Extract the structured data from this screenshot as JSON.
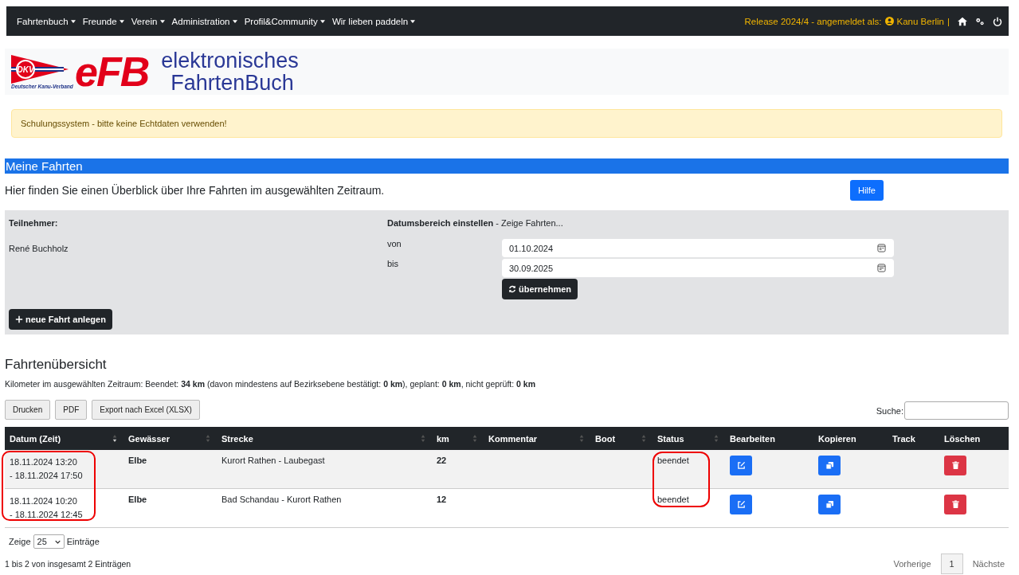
{
  "navbar": {
    "menus": [
      {
        "label": "Fahrtenbuch"
      },
      {
        "label": "Freunde"
      },
      {
        "label": "Verein"
      },
      {
        "label": "Administration"
      },
      {
        "label": "Profil&Community"
      },
      {
        "label": "Wir lieben paddeln"
      }
    ],
    "status_text": "Release 2024/4 - angemeldet als:",
    "user": "Kanu Berlin",
    "separator": "|"
  },
  "logo": {
    "badge": "DKV",
    "association": "Deutscher Kanu-Verband",
    "short": "eFB",
    "line_1": "elektronisches",
    "line_2": "FahrtenBuch"
  },
  "alert": "Schulungssystem - bitte keine Echtdaten verwenden!",
  "section": {
    "title": "Meine Fahrten",
    "description": "Hier finden Sie einen Überblick über Ihre Fahrten im ausgewählten Zeitraum.",
    "help_button": "Hilfe"
  },
  "filter": {
    "participant_label": "Teilnehmer:",
    "participant": "René Buchholz",
    "range_title": "**Datumsbereich einstellen** - Zeige Fahrten...",
    "from_label": "von",
    "from_value": "01.10.2024",
    "to_label": "bis",
    "to_value": "30.09.2025",
    "apply_button": "übernehmen",
    "new_button": "neue Fahrt anlegen"
  },
  "overview": {
    "title": "Fahrtenübersicht",
    "summary": "Kilometer im ausgewählten Zeitraum: Beendet: **34 km** (davon mindestens auf Bezirksebene bestätigt: **0 km**), geplant: **0 km**, nicht geprüft: **0 km**",
    "export_buttons": [
      "Drucken",
      "PDF",
      "Export nach Excel (XLSX)"
    ],
    "search_label": "Suche:"
  },
  "table": {
    "columns": [
      {
        "label": "Datum (Zeit)",
        "sortable": true,
        "sorted": true,
        "circled": true
      },
      {
        "label": "Gewässer",
        "sortable": true,
        "sorted": false,
        "circled": false
      },
      {
        "label": "Strecke",
        "sortable": true,
        "sorted": false,
        "circled": false
      },
      {
        "label": "km",
        "sortable": true,
        "sorted": false,
        "circled": false
      },
      {
        "label": "Kommentar",
        "sortable": true,
        "sorted": false,
        "circled": false
      },
      {
        "label": "Boot",
        "sortable": true,
        "sorted": false,
        "circled": false
      },
      {
        "label": "Status",
        "sortable": true,
        "sorted": false,
        "circled": true
      },
      {
        "label": "Bearbeiten",
        "sortable": false,
        "circled": false
      },
      {
        "label": "Kopieren",
        "sortable": false,
        "circled": false
      },
      {
        "label": "Track",
        "sortable": false,
        "circled": false
      },
      {
        "label": "Löschen",
        "sortable": false,
        "circled": false
      }
    ],
    "rows": [
      {
        "start": "18.11.2024 13:20",
        "end": "- 18.11.2024 17:50",
        "water": "Elbe",
        "route": "Kurort Rathen - Laubegast",
        "km": "22",
        "status": "beendet"
      },
      {
        "start": "18.11.2024 10:20",
        "end": "- 18.11.2024 12:45",
        "water": "Elbe",
        "route": "Bad Schandau - Kurort Rathen",
        "km": "12",
        "status": "beendet"
      }
    ]
  },
  "length": {
    "label_before": "Zeige",
    "value": "25",
    "label_after": "Einträge"
  },
  "info": "1 bis 2 von insgesamt 2 Einträgen",
  "pagination": {
    "previous": "Vorherige",
    "pages": [
      {
        "label": "1",
        "selected": true
      }
    ],
    "next": "Nächste"
  }
}
